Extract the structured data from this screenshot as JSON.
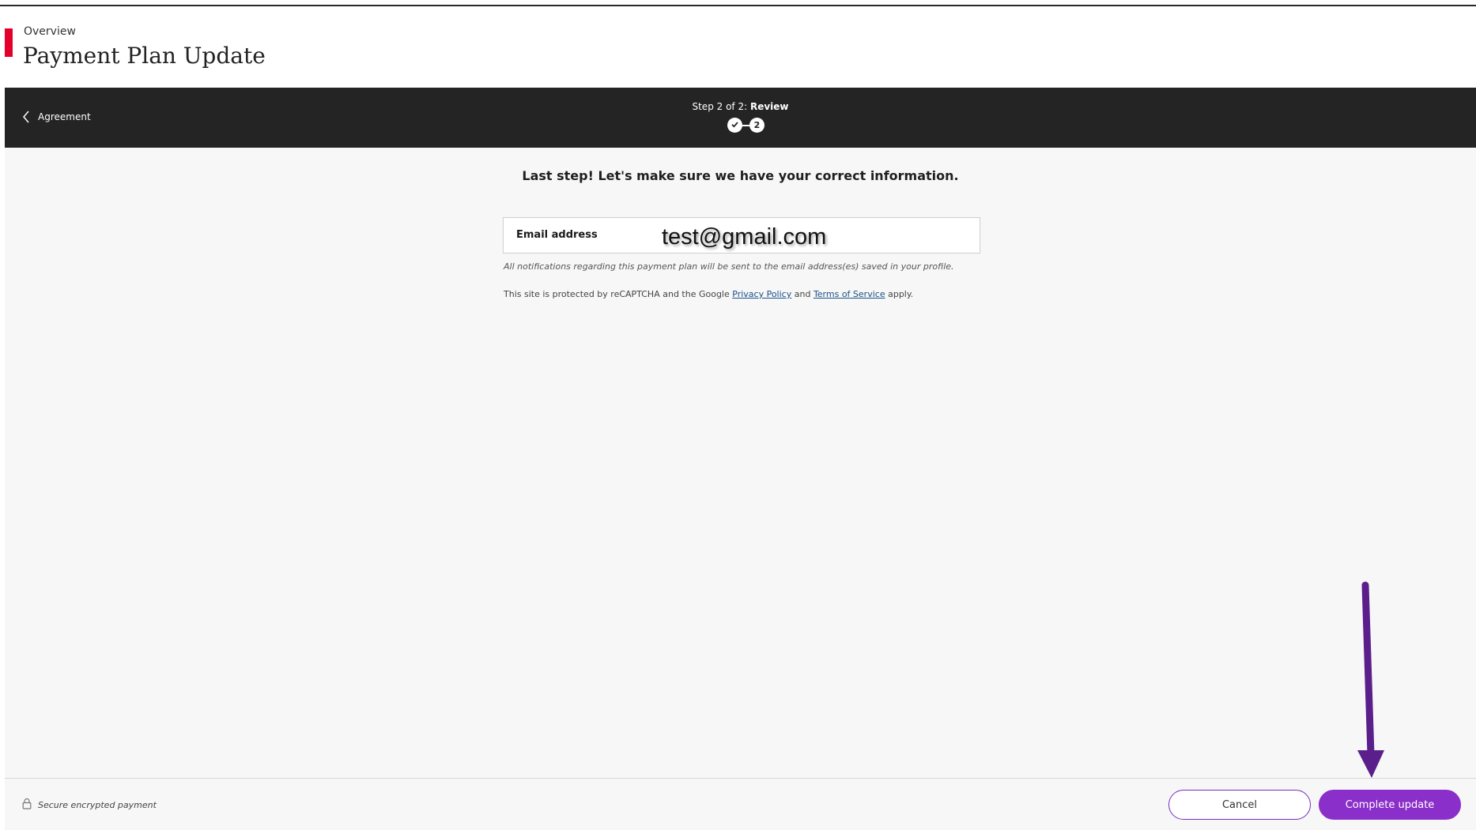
{
  "header": {
    "breadcrumb": "Overview",
    "title": "Payment Plan Update"
  },
  "steps": {
    "back_label": "Agreement",
    "progress_prefix": "Step 2 of 2: ",
    "current_step_name": "Review",
    "current_step_number": "2"
  },
  "main": {
    "intro": "Last step! Let's make sure we have your correct information.",
    "email_label": "Email address",
    "email_value": "test@gmail.com",
    "note": "All notifications regarding this payment plan will be sent to the email address(es) saved in your profile.",
    "recaptcha": {
      "prefix": "This site is protected by reCAPTCHA and the Google ",
      "privacy_link": "Privacy Policy",
      "middle": " and ",
      "terms_link": "Terms of Service",
      "suffix": " apply."
    }
  },
  "footer": {
    "secure_label": "Secure encrypted payment",
    "cancel_label": "Cancel",
    "complete_label": "Complete update"
  },
  "colors": {
    "brand_red": "#e4002b",
    "header_dark": "#242424",
    "accent_purple": "#8a2fc9",
    "annotation_arrow": "#5b1f8c"
  },
  "icons": {
    "back": "chevron-left-icon",
    "step_done": "check-icon",
    "secure": "lock-icon"
  }
}
